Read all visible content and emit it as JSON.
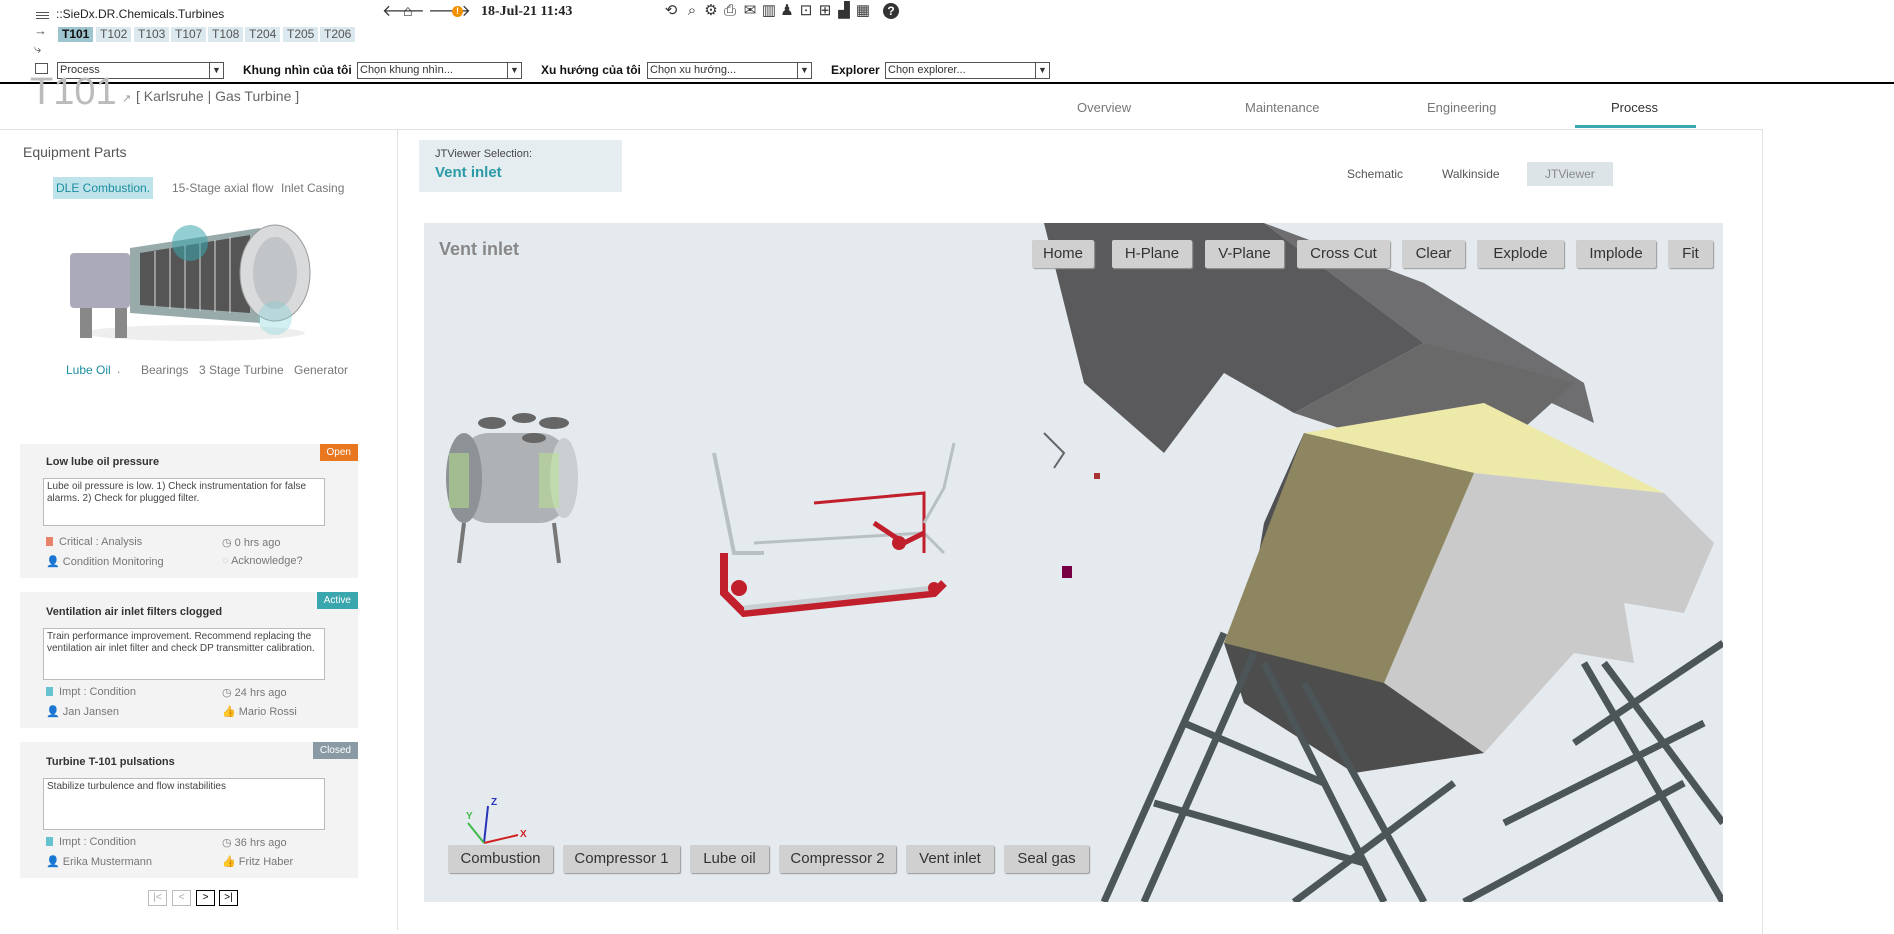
{
  "topbar": {
    "path": "::SieDx.DR.Chemicals.Turbines",
    "turbine_tabs": [
      "T101",
      "T102",
      "T103",
      "T107",
      "T108",
      "T204",
      "T205",
      "T206"
    ],
    "active_tab": "T101",
    "datetime": "18-Jul-21 11:43",
    "process_select": "Process",
    "view_label": "Khung nhìn của tôi",
    "view_select": "Chọn khung nhìn...",
    "trend_label": "Xu hướng của tôi",
    "trend_select": "Chọn xu hướng...",
    "explorer_label": "Explorer",
    "explorer_select": "Chọn explorer..."
  },
  "header": {
    "asset_id": "T101",
    "location": "[ Karlsruhe | Gas Turbine ]",
    "tabs": [
      "Overview",
      "Maintenance",
      "Engineering",
      "Process"
    ],
    "active_tab": "Process"
  },
  "equipment": {
    "title": "Equipment Parts",
    "top_parts": [
      "DLE Combustion.",
      "15-Stage axial flow",
      "Inlet Casing"
    ],
    "bottom_parts": [
      "Lube Oil",
      "Bearings",
      "3 Stage Turbine",
      "Generator"
    ]
  },
  "cards": [
    {
      "title": "Low lube oil pressure",
      "status": "Open",
      "status_color": "#e8771f",
      "text": "Lube oil pressure is low. 1) Check instrumentation for false alarms. 2) Check for plugged filter.",
      "severity": "Critical : Analysis",
      "severity_color": "#e9826a",
      "time": "0 hrs ago",
      "owner": "Condition Monitoring",
      "ack": "Acknowledge?"
    },
    {
      "title": "Ventilation air inlet filters clogged",
      "status": "Active",
      "status_color": "#3aa6ad",
      "text": "Train performance improvement. Recommend replacing the ventilation air inlet filter and check DP transmitter calibration.",
      "severity": "Impt : Condition",
      "severity_color": "#67c2cf",
      "time": "24 hrs ago",
      "owner": "Jan Jansen",
      "ack": "Mario Rossi"
    },
    {
      "title": "Turbine T-101 pulsations",
      "status": "Closed",
      "status_color": "#8a9aa4",
      "text": "Stabilize turbulence and flow instabilities",
      "severity": "Impt : Condition",
      "severity_color": "#67c2cf",
      "time": "36 hrs ago",
      "owner": "Erika Mustermann",
      "ack": "Fritz Haber"
    }
  ],
  "pagination": [
    "|<",
    "<",
    ">",
    ">|"
  ],
  "jtviewer": {
    "selection_label": "JTViewer Selection:",
    "selection_value": "Vent inlet",
    "view_tabs": [
      "Schematic",
      "Walkinside",
      "JTViewer"
    ],
    "active_view": "JTViewer",
    "viewer_title": "Vent inlet",
    "top_buttons": [
      "Home",
      "H-Plane",
      "V-Plane",
      "Cross Cut",
      "Clear",
      "Explode",
      "Implode",
      "Fit"
    ],
    "bottom_buttons": [
      "Combustion",
      "Compressor 1",
      "Lube oil",
      "Compressor 2",
      "Vent inlet",
      "Seal gas"
    ],
    "axes": {
      "x": "X",
      "y": "Y",
      "z": "Z"
    }
  }
}
